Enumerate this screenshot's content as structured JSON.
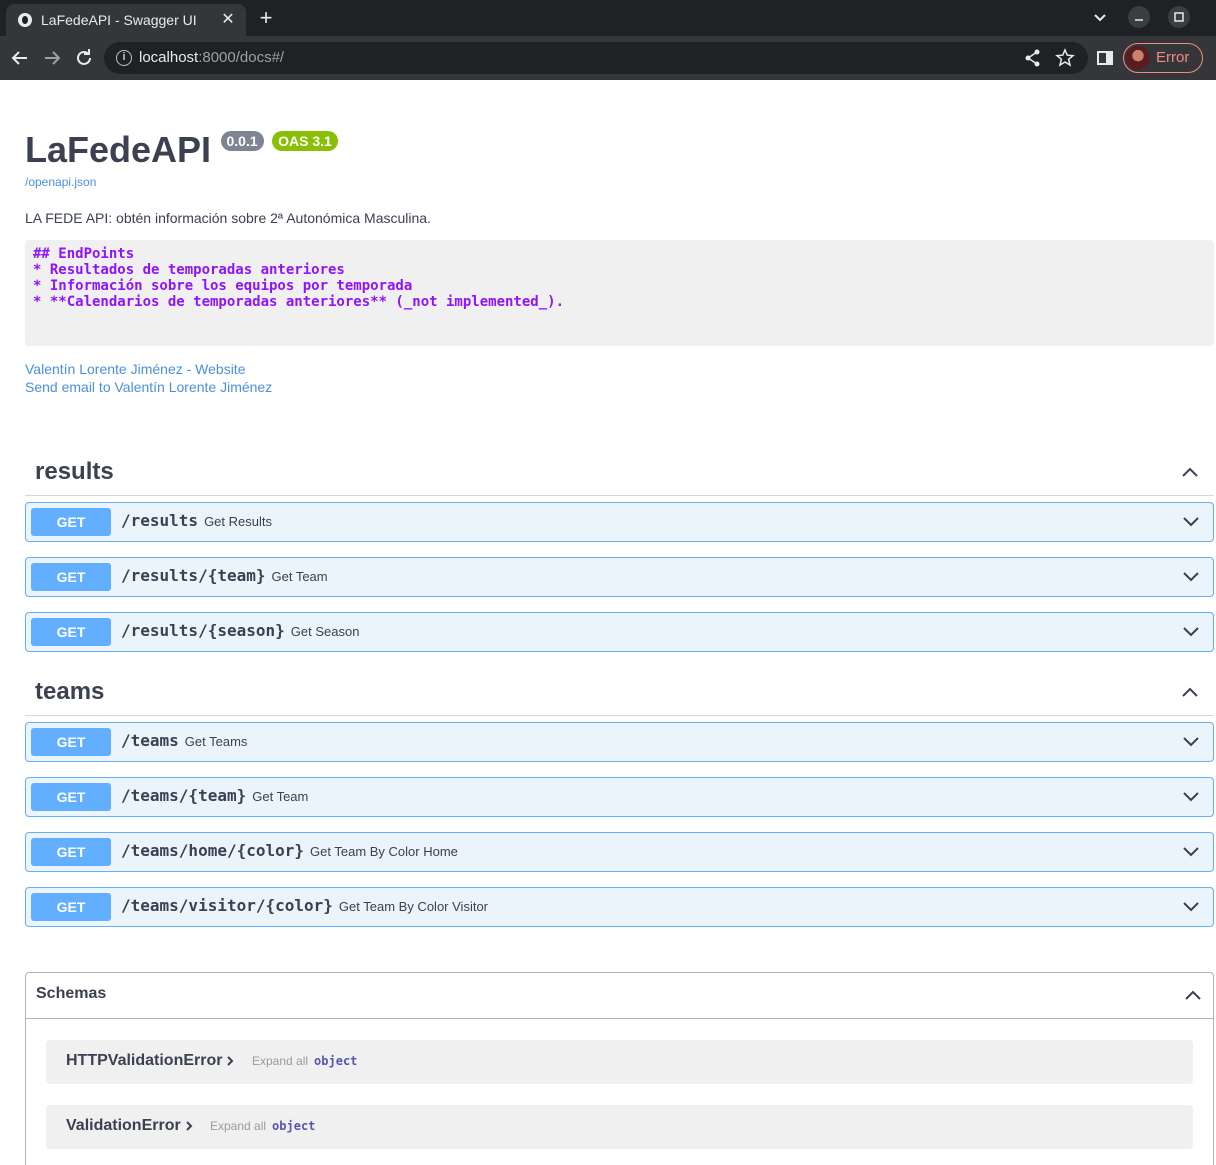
{
  "browser": {
    "tab_title": "LaFedeAPI - Swagger UI",
    "close_glyph": "✕",
    "newtab_glyph": "+",
    "url_host": "localhost",
    "url_rest": ":8000/docs#/",
    "profile_label": "Error",
    "icons": [
      "back-icon",
      "forward-icon",
      "reload-icon",
      "info-icon",
      "share-icon",
      "bookmark-star-icon",
      "side-panel-icon",
      "tab-search-icon",
      "minimize-icon",
      "maximize-icon"
    ]
  },
  "info": {
    "title": "LaFedeAPI",
    "version": "0.0.1",
    "oas": "OAS 3.1",
    "spec_link": "/openapi.json",
    "description": "LA FEDE API: obtén información sobre 2ª Autonómica Masculina.",
    "code_lines": [
      "## EndPoints",
      "",
      "* Resultados de temporadas anteriores",
      "* Información sobre los equipos por temporada",
      "",
      "* **Calendarios de temporadas anteriores** (_not implemented_)."
    ],
    "contact_website": "Valentín Lorente Jiménez - Website",
    "contact_email": "Send email to Valentín Lorente Jiménez"
  },
  "sections": [
    {
      "name": "results",
      "operations": [
        {
          "method": "GET",
          "path": "/results",
          "summary": "Get Results"
        },
        {
          "method": "GET",
          "path": "/results/{team}",
          "summary": "Get Team"
        },
        {
          "method": "GET",
          "path": "/results/{season}",
          "summary": "Get Season"
        }
      ]
    },
    {
      "name": "teams",
      "operations": [
        {
          "method": "GET",
          "path": "/teams",
          "summary": "Get Teams"
        },
        {
          "method": "GET",
          "path": "/teams/{team}",
          "summary": "Get Team"
        },
        {
          "method": "GET",
          "path": "/teams/home/{color}",
          "summary": "Get Team By Color Home"
        },
        {
          "method": "GET",
          "path": "/teams/visitor/{color}",
          "summary": "Get Team By Color Visitor"
        }
      ]
    }
  ],
  "schemas": {
    "title": "Schemas",
    "models": [
      {
        "name": "HTTPValidationError",
        "expand": "Expand all",
        "type": "object"
      },
      {
        "name": "ValidationError",
        "expand": "Expand all",
        "type": "object"
      }
    ]
  },
  "colors": {
    "get_method": "#61affe",
    "get_background": "#ebf3fb",
    "link": "#4990e2",
    "code_text": "#9012fe",
    "oas_badge": "#89bf04",
    "version_badge": "#7d8492",
    "profile_error": "#f28b82"
  }
}
